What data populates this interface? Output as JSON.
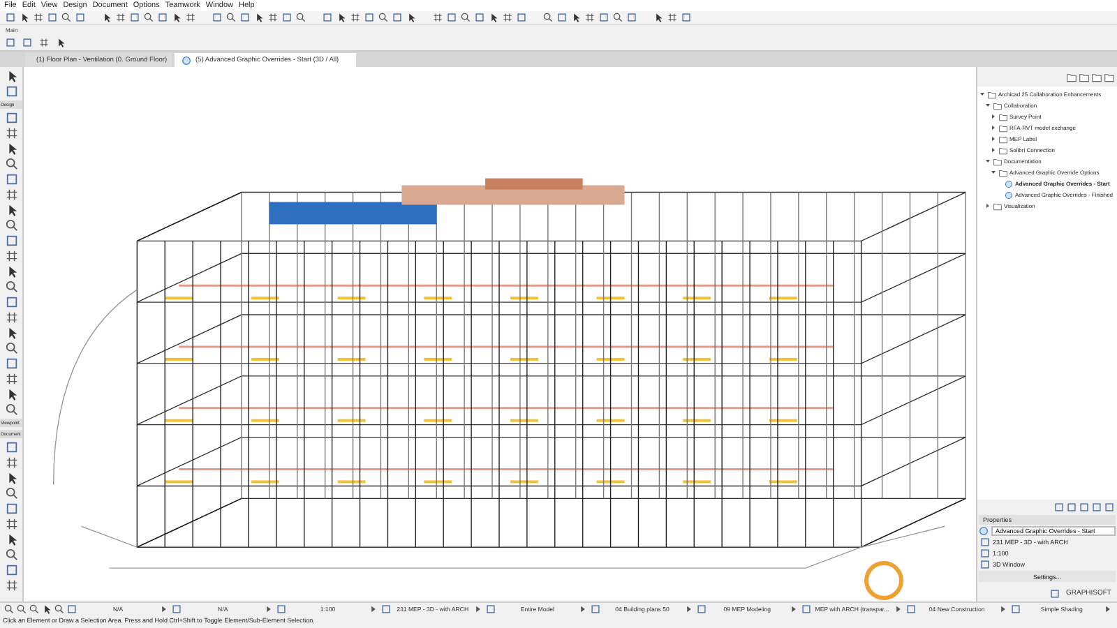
{
  "menu": [
    "File",
    "Edit",
    "View",
    "Design",
    "Document",
    "Options",
    "Teamwork",
    "Window",
    "Help"
  ],
  "info_box": {
    "title": "Main"
  },
  "tabs": [
    {
      "label": "(1) Floor Plan - Ventilation (0. Ground Floor)",
      "selected": false
    },
    {
      "label": "(5) Advanced Graphic Overrides - Start (3D / All)",
      "selected": true
    }
  ],
  "toolbox": {
    "sections": [
      "Design",
      "Viewpoint",
      "Document"
    ]
  },
  "navigator": {
    "tree": [
      {
        "label": "Archicad 25 Collaboration Enhancements",
        "kind": "project",
        "expanded": true,
        "selected": false,
        "children": [
          {
            "label": "Collaboration",
            "kind": "folder",
            "expanded": true,
            "selected": false,
            "children": [
              {
                "label": "Survey Point",
                "kind": "folder",
                "expanded": false,
                "selected": false
              },
              {
                "label": "RFA-RVT model exchange",
                "kind": "folder",
                "expanded": false,
                "selected": false
              },
              {
                "label": "MEP Label",
                "kind": "folder",
                "expanded": false,
                "selected": false
              },
              {
                "label": "Solibri Connection",
                "kind": "folder",
                "expanded": false,
                "selected": false
              }
            ]
          },
          {
            "label": "Documentation",
            "kind": "folder",
            "expanded": true,
            "selected": false,
            "children": [
              {
                "label": "Advanced Graphic Override Options",
                "kind": "folder",
                "expanded": true,
                "selected": false,
                "children": [
                  {
                    "label": "Advanced Graphic Overrides - Start",
                    "kind": "view",
                    "selected": true
                  },
                  {
                    "label": "Advanced Graphic Overrides - Finished",
                    "kind": "view",
                    "selected": false
                  }
                ]
              }
            ]
          },
          {
            "label": "Visualization",
            "kind": "folder",
            "expanded": false,
            "selected": false
          }
        ]
      }
    ]
  },
  "properties": {
    "title": "Properties",
    "name": "Advanced Graphic Overrides - Start",
    "rows": [
      "231 MEP - 3D - with ARCH",
      "1:100",
      "3D Window"
    ],
    "button": "Settings..."
  },
  "brand": "GRAPHISOFT",
  "quick_options": [
    "N/A",
    "N/A",
    "1:100",
    "231 MEP - 3D - with ARCH",
    "Entire Model",
    "04 Building plans 50",
    "09 MEP Modeling",
    "MEP with ARCH (transpar...",
    "04 New Construction",
    "Simple Shading"
  ],
  "status_bar": "Click an Element or Draw a Selection Area. Press and Hold Ctrl+Shift to Toggle Element/Sub-Element Selection."
}
